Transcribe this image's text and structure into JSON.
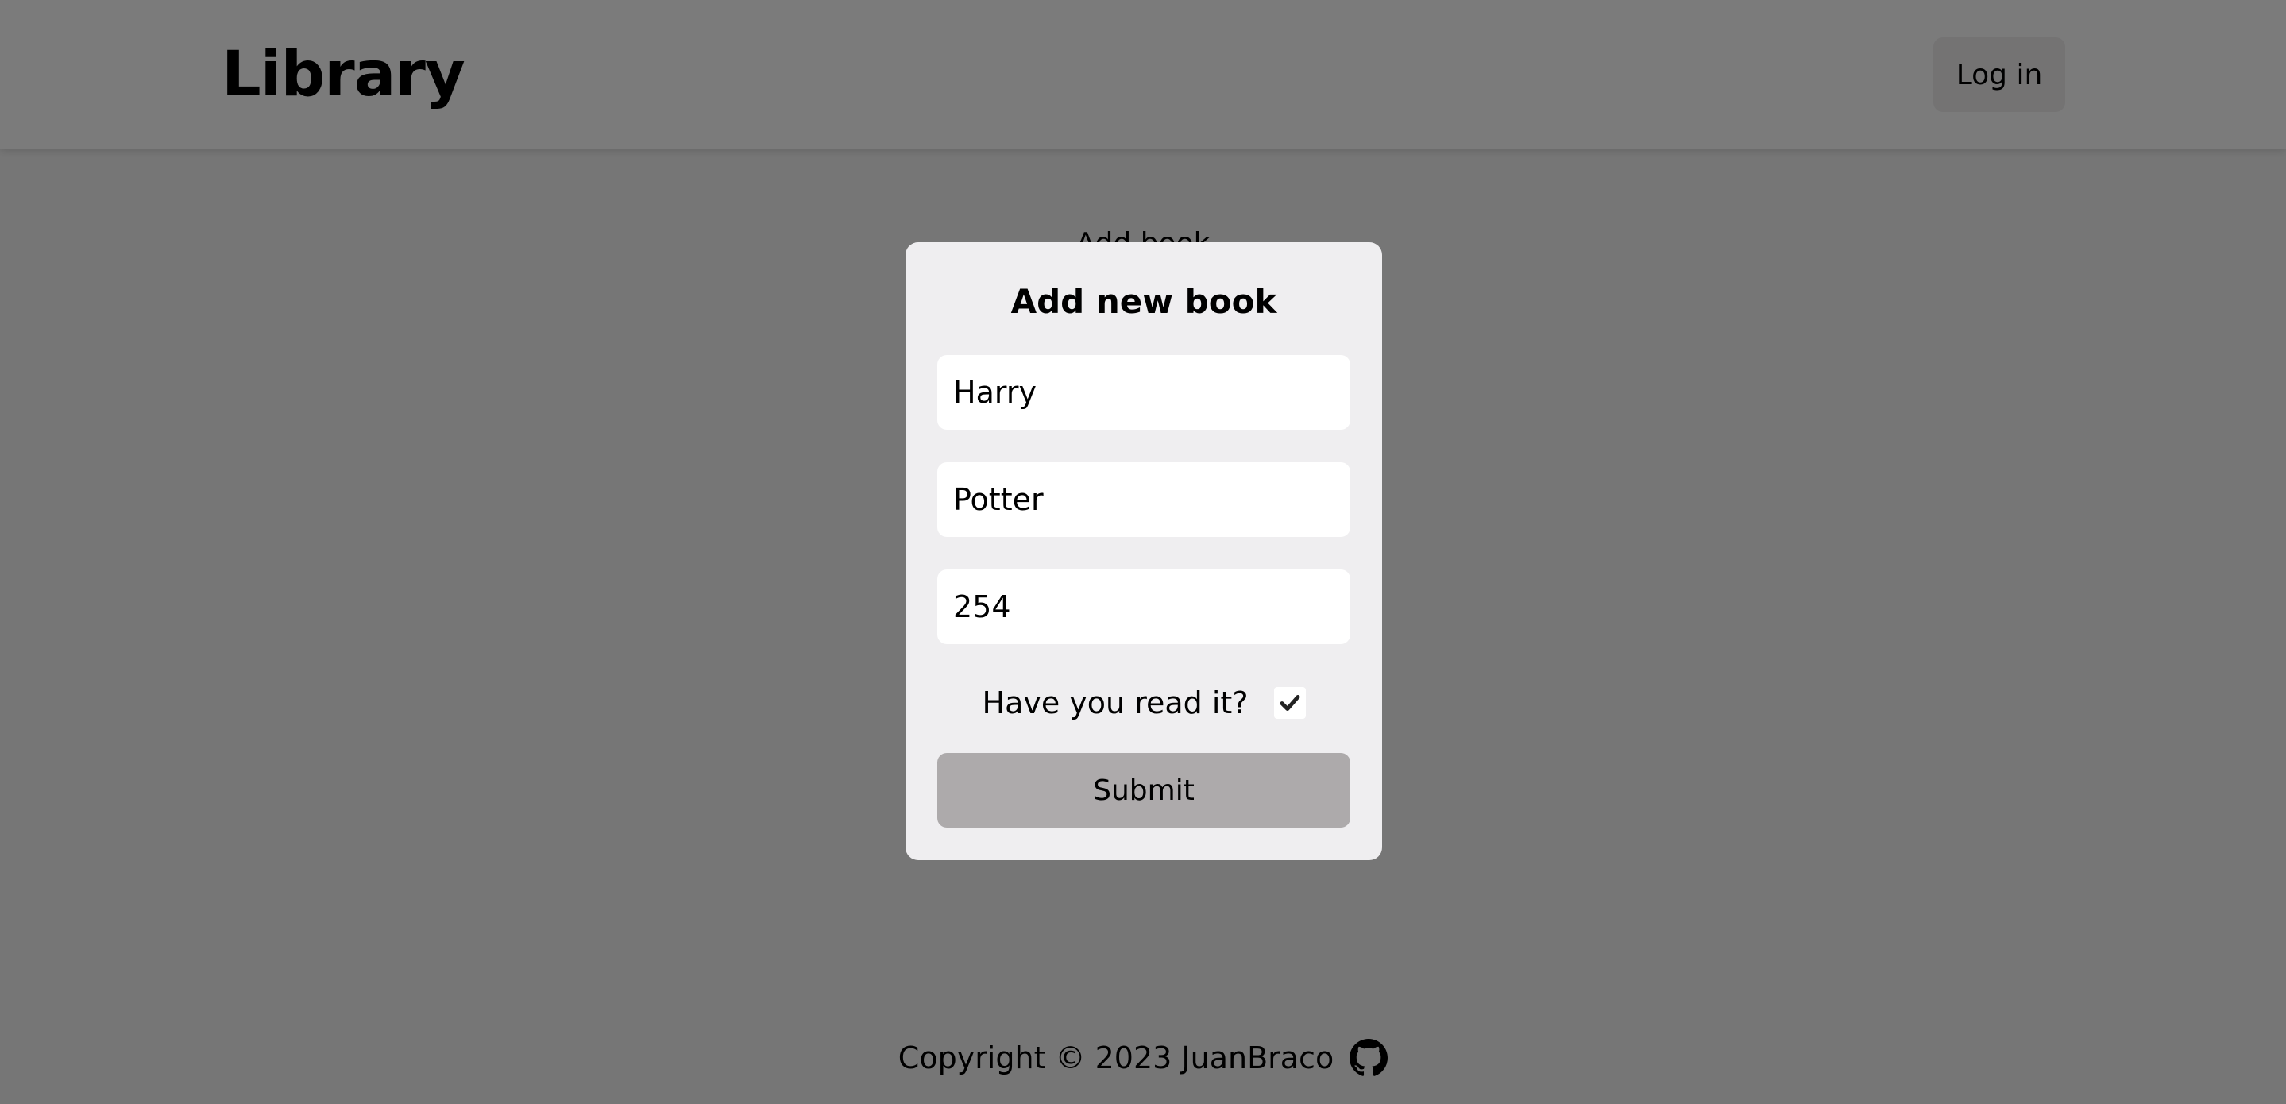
{
  "header": {
    "logo": "Library",
    "login_label": "Log in"
  },
  "main": {
    "add_book_label": "Add book"
  },
  "footer": {
    "copyright": "Copyright © 2023 JuanBraco",
    "icon": "github-icon"
  },
  "modal": {
    "title": "Add new book",
    "fields": {
      "title_value": "Harry",
      "author_value": "Potter",
      "pages_value": "254"
    },
    "read_label": "Have you read it?",
    "read_checked": true,
    "submit_label": "Submit"
  },
  "colors": {
    "overlay": "rgba(0,0,0,0.5)",
    "modal_bg": "#efeef0",
    "submit_bg": "#adaaab"
  }
}
